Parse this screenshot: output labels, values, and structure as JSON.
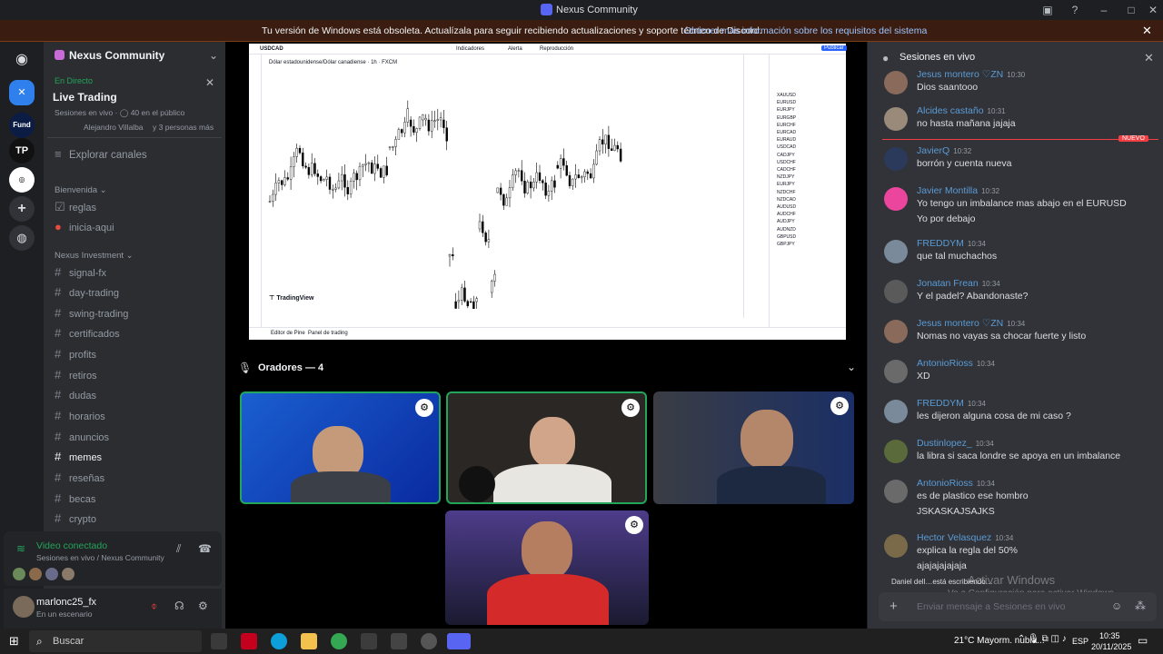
{
  "window": {
    "title": "Nexus Community"
  },
  "banner": {
    "text": "Tu versión de Windows está obsoleta. Actualízala para seguir recibiendo actualizaciones y soporte técnico de Discord.",
    "link": "Obtener más información sobre los requisitos del sistema"
  },
  "server": {
    "name": "Nexus Community"
  },
  "live": {
    "status": "En Directo",
    "title": "Live Trading",
    "meta": "Sesiones en vivo · ◯ 40 en el público",
    "hosts": "Alejandro Villalba",
    "others": "y 3 personas más"
  },
  "explore": "Explorar canales",
  "categories": [
    {
      "name": "Bienvenida",
      "channels": [
        "reglas",
        "inicia-aqui"
      ]
    },
    {
      "name": "Nexus Investment",
      "channels": [
        "signal-fx",
        "day-trading",
        "swing-trading",
        "certificados",
        "profits",
        "retiros",
        "dudas",
        "horarios",
        "anuncios",
        "memes",
        "reseñas",
        "becas",
        "crypto"
      ]
    }
  ],
  "voice": {
    "status": "Video conectado",
    "sub": "Sesiones en vivo / Nexus Community"
  },
  "user": {
    "name": "marlonc25_fx",
    "status": "En un escenario"
  },
  "chart": {
    "symbol": "USDCAD",
    "pair_label": "Dólar estadounidense/Dólar canadiense · 1h · FXCM",
    "brand": "TradingView",
    "tools": [
      "Indicadores",
      "Alerta",
      "Reproducción"
    ],
    "publish": "Publicar",
    "bottom_tabs": [
      "Editor de Pine",
      "Panel de trading"
    ],
    "watchlist": [
      "XAUUSD",
      "EURUSD",
      "EURJPY",
      "EURGBP",
      "EURCHF",
      "EURCAD",
      "EURAUD",
      "USDCAD",
      "CADJPY",
      "USDCHF",
      "CADCHF",
      "NZDJPY",
      "EURJPY",
      "NZDCHF",
      "NZDCAD",
      "AUDUSD",
      "AUDCHF",
      "AUDJPY",
      "AUDNZD",
      "GBPUSD",
      "GBPJPY"
    ]
  },
  "speakers": {
    "label": "Oradores — 4"
  },
  "chat": {
    "title": "Sesiones en vivo",
    "new_badge": "NUEVO",
    "input_placeholder": "Enviar mensaje a Sesiones en vivo",
    "messages": [
      {
        "name": "Jesus  montero",
        "tag": "ZN",
        "time": "10:30",
        "lines": [
          "Dios saantooo"
        ]
      },
      {
        "name": "Alcides castaño",
        "time": "10:31",
        "lines": [
          "no hasta mañana jajaja"
        ]
      },
      {
        "name": "JavierQ",
        "time": "10:32",
        "lines": [
          "borrón y cuenta nueva"
        ]
      },
      {
        "name": "Javier Montilla",
        "time": "10:32",
        "lines": [
          "Yo tengo un imbalance mas abajo en el EURUSD",
          "Yo por debajo"
        ]
      },
      {
        "name": "FREDDYM",
        "time": "10:34",
        "lines": [
          "que tal muchachos"
        ]
      },
      {
        "name": "Jonatan Frean",
        "time": "10:34",
        "lines": [
          "Y el padel? Abandonaste?"
        ]
      },
      {
        "name": "Jesus  montero",
        "tag": "ZN",
        "time": "10:34",
        "lines": [
          "Nomas no vayas sa chocar fuerte y listo"
        ]
      },
      {
        "name": "AntonioRioss",
        "time": "10:34",
        "lines": [
          "XD"
        ]
      },
      {
        "name": "FREDDYM",
        "time": "10:34",
        "lines": [
          "les dijeron alguna cosa de mi caso ?"
        ]
      },
      {
        "name": "Dustinlopez_",
        "time": "10:34",
        "lines": [
          "la libra si saca londre se apoya en un imbalance"
        ]
      },
      {
        "name": "AntonioRioss",
        "time": "10:34",
        "lines": [
          "es de plastico ese hombro",
          "JSKASKAJSAJKS"
        ]
      },
      {
        "name": "Hector Velasquez",
        "time": "10:34",
        "lines": [
          "explica la regla del 50%",
          "ajajajajajaja"
        ]
      }
    ],
    "typing": "Daniel dell…está escribiendo…",
    "watermark1": "Activar Windows",
    "watermark2": "Ve a Configuración para activar Windows."
  },
  "taskbar": {
    "search": "Buscar",
    "weather": "21°C  Mayorm. nubla...",
    "lang": "ESP",
    "time": "10:35",
    "date": "20/11/2025"
  }
}
